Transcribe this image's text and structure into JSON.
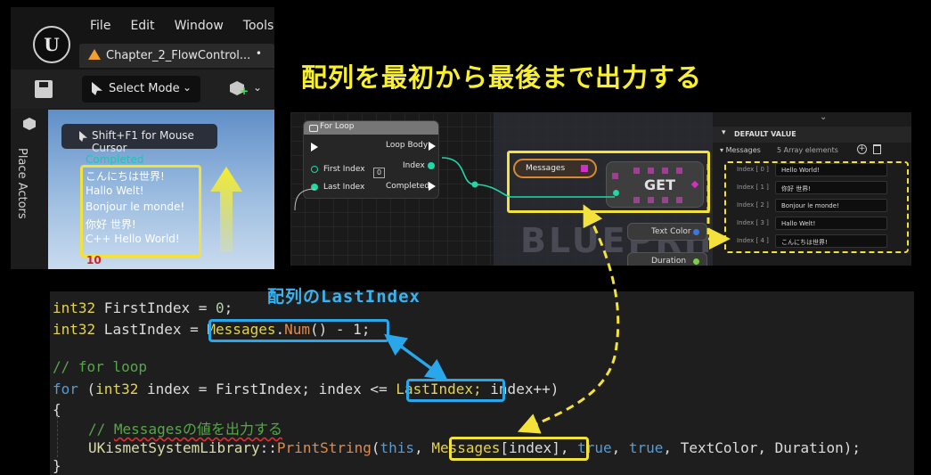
{
  "title": "配列を最初から最後まで出力する",
  "subtitle": "配列のLastIndex",
  "editor": {
    "menu": [
      "File",
      "Edit",
      "Window",
      "Tools"
    ],
    "tab_title": "Chapter_2_FlowControl...",
    "tab_modified": "•",
    "select_mode": "Select Mode",
    "side_label": "Place Actors",
    "viewport_button": "Shift+F1 for Mouse Cursor",
    "log_completed": "Completed",
    "log_lines": [
      "こんにちは世界!",
      "Hallo Welt!",
      "Bonjour le monde!",
      "你好 世界!",
      "C++ Hello World!"
    ],
    "log_trailing": "10"
  },
  "blueprint": {
    "node_title": "For Loop",
    "pin_first_index": "First Index",
    "first_index_value": "0",
    "pin_last_index": "Last Index",
    "pin_loop_body": "Loop Body",
    "pin_index": "Index",
    "pin_completed": "Completed",
    "messages_var": "Messages",
    "get_label": "GET",
    "text_color_var": "Text Color",
    "duration_var": "Duration",
    "watermark": "BLUEPRINT",
    "colors": {
      "array_pin": "#d030c8",
      "int_pin": "#1fd8a8",
      "highlight": "#f3e23b"
    }
  },
  "details": {
    "section": "DEFAULT VALUE",
    "property": "Messages",
    "count": "5 Array elements",
    "elements": [
      {
        "key": "Index [ 0 ]",
        "value": "Hello World!"
      },
      {
        "key": "Index [ 1 ]",
        "value": "你好 世界!"
      },
      {
        "key": "Index [ 2 ]",
        "value": "Bonjour le monde!"
      },
      {
        "key": "Index [ 3 ]",
        "value": "Hallo Welt!"
      },
      {
        "key": "Index [ 4 ]",
        "value": "こんにちは世界!"
      }
    ]
  },
  "code": {
    "line1": {
      "type": "int32",
      "rest": " FirstIndex = ",
      "num": "0",
      "end": ";"
    },
    "line2": {
      "type": "int32",
      "rest": " LastIndex = ",
      "obj": "Messages",
      "dot": ".",
      "fn": "Num",
      "tail": "() - 1;"
    },
    "line3": "// for loop",
    "line4": {
      "kw": "for",
      "p1": " (",
      "type": "int32",
      "p2": " index = FirstIndex; index <= ",
      "hl": "LastIndex;",
      "p3": " index++)"
    },
    "brace_open": "{",
    "line6": {
      "prefix": "// ",
      "word": "Messagesの値を出力する"
    },
    "line7": {
      "cls": "UKismetSystemLibrary",
      "sep": "::",
      "fn": "PrintString",
      "p1": "(",
      "this": "this",
      "p2": ", ",
      "hl_obj": "Messages",
      "hl_idx": "[index]",
      "p3": ", ",
      "t1": "true",
      "p4": ", ",
      "t2": "true",
      "p5": ", TextColor, Duration);"
    },
    "brace_close": "}"
  }
}
